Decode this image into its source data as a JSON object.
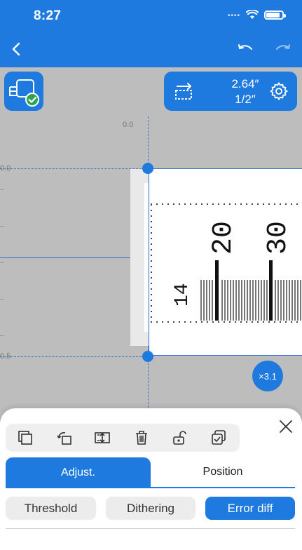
{
  "status": {
    "time": "8:27"
  },
  "canvas": {
    "label_size": {
      "width": "2.64″",
      "height": "1/2″"
    },
    "ruler": {
      "top": "0.0",
      "left_top": "0.0",
      "left_bottom": "0.5"
    },
    "zoom": "×3.1",
    "label_text": {
      "number_left": "14",
      "number_mid": "20",
      "number_right": "30"
    }
  },
  "sheet": {
    "tabs": [
      "Adjust.",
      "Position"
    ],
    "modes": [
      "Threshold",
      "Dithering",
      "Error diff"
    ],
    "active_mode": "Error diff"
  },
  "colors": {
    "accent": "#1f7ae0",
    "canvas_bg": "#bdbdbd"
  },
  "icons": [
    "back-icon",
    "undo-icon",
    "redo-icon",
    "label-select-icon",
    "rotate-label-icon",
    "settings-gear-icon",
    "copy-icon",
    "rotate-left-icon",
    "fit-height-icon",
    "trash-icon",
    "unlock-icon",
    "layers-icon",
    "close-icon"
  ]
}
